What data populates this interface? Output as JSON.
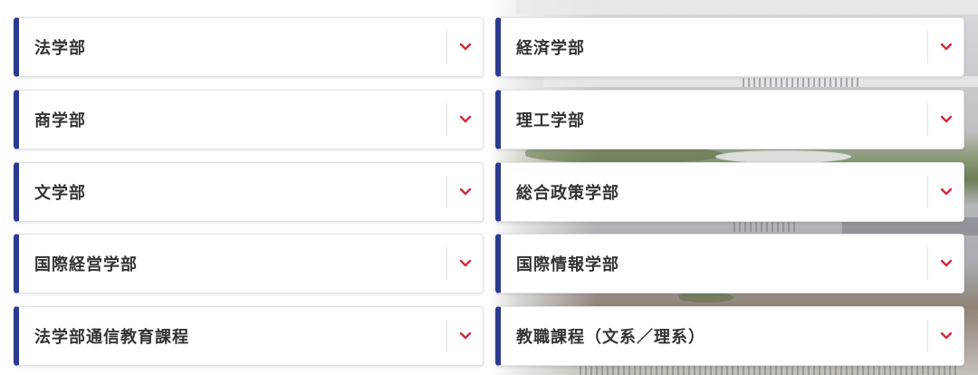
{
  "accent_color": "#2b3a8f",
  "chevron_color": "#d6263b",
  "faculties": {
    "left": [
      {
        "label": "法学部"
      },
      {
        "label": "商学部"
      },
      {
        "label": "文学部"
      },
      {
        "label": "国際経営学部"
      },
      {
        "label": "法学部通信教育課程"
      }
    ],
    "right": [
      {
        "label": "経済学部"
      },
      {
        "label": "理工学部"
      },
      {
        "label": "総合政策学部"
      },
      {
        "label": "国際情報学部"
      },
      {
        "label": "教職課程（文系／理系）"
      }
    ]
  },
  "toggle_icon": "chevron-down-icon"
}
